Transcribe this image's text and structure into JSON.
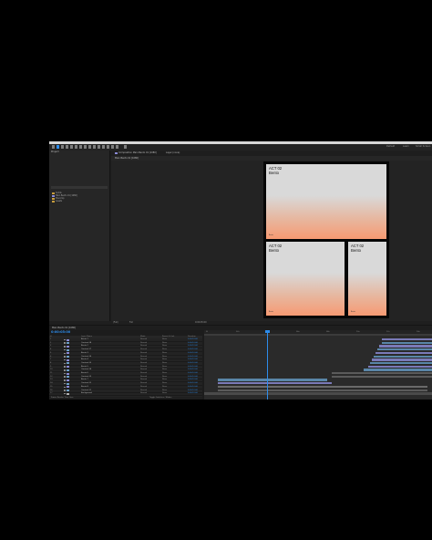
{
  "app": {
    "workspace_tabs": [
      "Default",
      "Learn",
      "Small Screen"
    ]
  },
  "project": {
    "tab_label": "Project",
    "items": [
      {
        "type": "folder",
        "label": "Solids"
      },
      {
        "type": "comp",
        "label": "Main Bento 01 [1080]"
      },
      {
        "type": "folder",
        "label": "Precomp"
      },
      {
        "type": "folder",
        "label": "Assets"
      }
    ]
  },
  "composition": {
    "tab_label": "Composition  Main Bento 01 [1080]",
    "subtab_label": "Main Bento 01 [1080]",
    "layer_tab": "Layer (none)",
    "cards": [
      {
        "title": "ACT 02\nBento",
        "footer": "Bento"
      },
      {
        "title": "ACT 02\nBento",
        "footer": "Bento"
      },
      {
        "title": "ACT 02\nBento",
        "footer": "Bento"
      }
    ],
    "gradient": {
      "top": "#d9d9d9",
      "bottom": "#f79a72"
    }
  },
  "viewer_bar": {
    "zoom": "(Full)",
    "resolution": "Full",
    "timecode": "0:00:05:00"
  },
  "timeline": {
    "tab_label": "Main Bento 01 [1080]",
    "current_time": "0:00:05:00",
    "columns": [
      "#",
      "Layer Name",
      "Mode",
      "Parent & Link",
      "Duration"
    ],
    "ruler_marks": [
      "0f",
      "02s",
      "04s",
      "06s",
      "08s",
      "10s",
      "12s",
      "14s"
    ],
    "layers": [
      {
        "num": "1",
        "name": "Bento 1",
        "mode": "Normal",
        "parent": "None",
        "duration": "0:00:10:00",
        "color": "#8a8ad6"
      },
      {
        "num": "2",
        "name": "Content 08",
        "mode": "Normal",
        "parent": "None",
        "duration": "0:00:10:00",
        "color": "#6ca0c8"
      },
      {
        "num": "3",
        "name": "Bento 2",
        "mode": "Normal",
        "parent": "None",
        "duration": "0:00:10:00",
        "color": "#8a8ad6"
      },
      {
        "num": "4",
        "name": "Content 07",
        "mode": "Normal",
        "parent": "None",
        "duration": "0:00:10:00",
        "color": "#6ca0c8"
      },
      {
        "num": "5",
        "name": "Bento 3",
        "mode": "Normal",
        "parent": "None",
        "duration": "0:00:10:00",
        "color": "#8a8ad6"
      },
      {
        "num": "6",
        "name": "Content 06",
        "mode": "Normal",
        "parent": "None",
        "duration": "0:00:10:00",
        "color": "#6ca0c8"
      },
      {
        "num": "7",
        "name": "Bento 4",
        "mode": "Normal",
        "parent": "None",
        "duration": "0:00:10:00",
        "color": "#8a8ad6"
      },
      {
        "num": "8",
        "name": "Content 05",
        "mode": "Normal",
        "parent": "None",
        "duration": "0:00:10:00",
        "color": "#6ca0c8"
      },
      {
        "num": "9",
        "name": "Bento 5",
        "mode": "Normal",
        "parent": "None",
        "duration": "0:00:10:00",
        "color": "#8a8ad6"
      },
      {
        "num": "10",
        "name": "Content 04",
        "mode": "Normal",
        "parent": "None",
        "duration": "0:00:10:00",
        "color": "#6ca0c8"
      },
      {
        "num": "11",
        "name": "Bento 6",
        "mode": "Normal",
        "parent": "None",
        "duration": "0:00:10:00",
        "color": "#8a8ad6"
      },
      {
        "num": "12",
        "name": "Content 03",
        "mode": "Normal",
        "parent": "None",
        "duration": "0:00:10:00",
        "color": "#6ca0c8"
      },
      {
        "num": "13",
        "name": "Bento 7",
        "mode": "Normal",
        "parent": "None",
        "duration": "0:00:10:00",
        "color": "#8a8ad6"
      },
      {
        "num": "14",
        "name": "Content 02",
        "mode": "Normal",
        "parent": "None",
        "duration": "0:00:10:00",
        "color": "#6ca0c8"
      },
      {
        "num": "15",
        "name": "Bento 8",
        "mode": "Normal",
        "parent": "None",
        "duration": "0:00:10:00",
        "color": "#8a8ad6"
      },
      {
        "num": "16",
        "name": "Content 01",
        "mode": "Normal",
        "parent": "None",
        "duration": "0:00:10:00",
        "color": "#6ca0c8"
      },
      {
        "num": "17",
        "name": "Background",
        "mode": "Normal",
        "parent": "None",
        "duration": "0:00:10:00",
        "color": "#b0b0b0"
      }
    ],
    "footer_label": "Frame Render Time 0ms",
    "toggle_label": "Toggle Switches / Modes"
  }
}
